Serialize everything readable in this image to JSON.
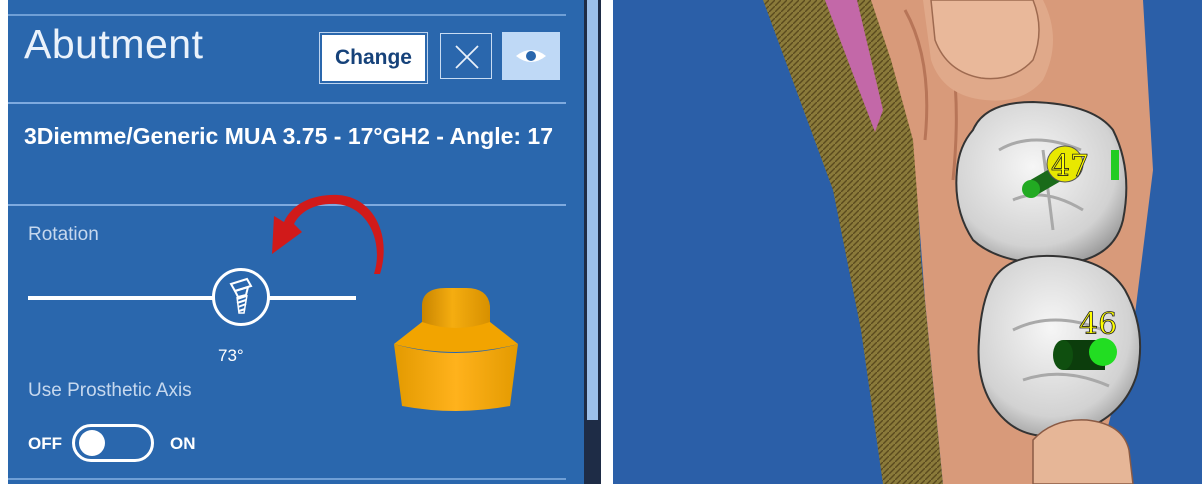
{
  "panel": {
    "title": "Abutment",
    "change_label": "Change",
    "component_name": "3Diemme/Generic MUA 3.75 - 17°GH2 - Angle: 17",
    "rotation_label": "Rotation",
    "rotation_value": "73°",
    "prosthetic_axis_label": "Use Prosthetic Axis",
    "toggle_off": "OFF",
    "toggle_on": "ON",
    "prosthetic_axis_enabled": false
  },
  "icons": {
    "close": "close-icon",
    "visibility": "eye-icon",
    "rotation_handle": "implant-screw-icon",
    "rotate_arrow": "rotate-arrow-icon"
  },
  "viewport": {
    "tooth_labels": [
      "47",
      "46"
    ]
  },
  "colors": {
    "panel_bg": "#2a67ad",
    "viewport_bg": "#2b5fa8",
    "abutment": "#f0a000",
    "arrow": "#d11a1a",
    "gingiva": "#d89a7a",
    "tooth": "#e6e6e6",
    "implant_marker": "#22cc22",
    "label": "#ffff00"
  }
}
